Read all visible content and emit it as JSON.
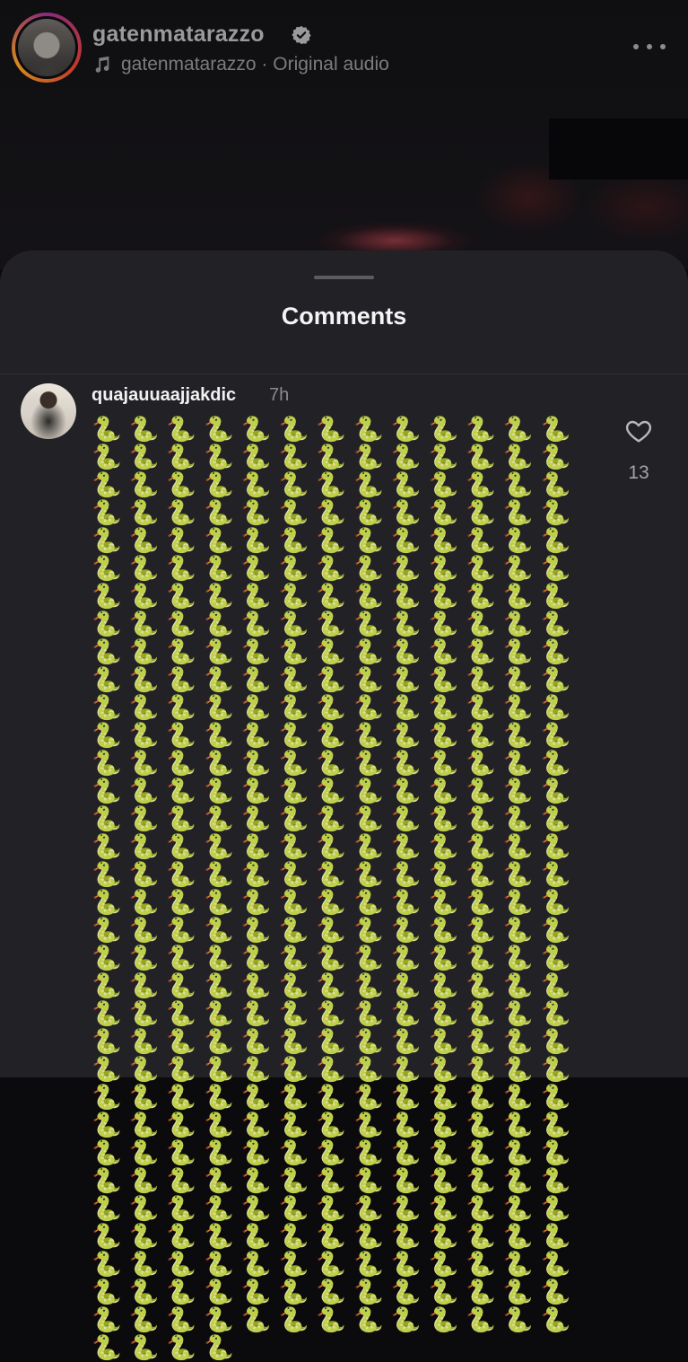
{
  "reel": {
    "username": "gatenmatarazzo",
    "verified": true,
    "audio_credit": "gatenmatarazzo · Original audio"
  },
  "comments_sheet": {
    "title": "Comments",
    "comments": [
      {
        "username": "quajauuaajjakdic",
        "time": "7h",
        "body": "🐍🐍🐍🐍🐍🐍🐍🐍🐍🐍🐍🐍🐍🐍🐍🐍🐍🐍🐍🐍🐍🐍🐍🐍🐍🐍🐍🐍🐍🐍🐍🐍🐍🐍🐍🐍🐍🐍🐍🐍🐍🐍🐍🐍🐍🐍🐍🐍🐍🐍🐍🐍🐍🐍🐍🐍🐍🐍🐍🐍🐍🐍🐍🐍🐍🐍🐍🐍🐍🐍🐍🐍🐍🐍🐍🐍🐍🐍🐍🐍🐍🐍🐍🐍🐍🐍🐍🐍🐍🐍🐍🐍🐍🐍🐍🐍🐍🐍🐍🐍🐍🐍🐍🐍🐍🐍🐍🐍🐍🐍🐍🐍🐍🐍🐍🐍🐍🐍🐍🐍🐍🐍🐍🐍🐍🐍🐍🐍🐍🐍🐍🐍🐍🐍🐍🐍🐍🐍🐍🐍🐍🐍🐍🐍🐍🐍🐍🐍🐍🐍🐍🐍🐍🐍🐍🐍🐍🐍🐍🐍🐍🐍🐍🐍🐍🐍🐍🐍🐍🐍🐍🐍🐍🐍🐍🐍🐍🐍🐍🐍🐍🐍🐍🐍🐍🐍🐍🐍🐍🐍🐍🐍🐍🐍🐍🐍🐍🐍🐍🐍🐍🐍🐍🐍🐍🐍🐍🐍🐍🐍🐍🐍🐍🐍🐍🐍🐍🐍🐍🐍🐍🐍🐍🐍🐍🐍🐍🐍🐍🐍🐍🐍🐍🐍🐍🐍🐍🐍🐍🐍🐍🐍🐍🐍🐍🐍🐍🐍🐍🐍🐍🐍🐍🐍🐍🐍🐍🐍🐍🐍🐍🐍🐍🐍🐍🐍🐍🐍🐍🐍🐍🐍🐍🐍🐍🐍🐍🐍🐍🐍🐍🐍🐍🐍🐍🐍🐍🐍🐍🐍🐍🐍🐍🐍🐍🐍🐍🐍🐍🐍🐍🐍🐍🐍🐍🐍🐍🐍🐍🐍🐍🐍🐍🐍🐍🐍🐍🐍🐍🐍🐍🐍🐍🐍🐍🐍🐍🐍🐍🐍🐍🐍🐍🐍🐍🐍🐍🐍🐍🐍🐍🐍🐍🐍🐍🐍🐍🐍🐍🐍🐍🐍🐍🐍🐍🐍🐍🐍🐍🐍🐍🐍🐍🐍🐍🐍🐍🐍🐍🐍🐍🐍🐍🐍🐍🐍🐍🐍🐍🐍🐍🐍🐍🐍🐍🐍🐍🐍🐍🐍🐍🐍🐍🐍🐍🐍🐍🐍🐍🐍🐍🐍🐍🐍🐍🐍🐍🐍🐍🐍🐍🐍🐍🐍🐍🐍🐍🐍🐍🐍🐍🐍🐍🐍🐍🐍🐍🐍🐍🐍🐍🐍🐍",
        "like_count": "13",
        "like_icon": "heart-outline-icon"
      }
    ]
  },
  "colors": {
    "sheet_background": "#222226",
    "reel_background": "#0b0b0d",
    "story_ring": "#c0392b"
  }
}
